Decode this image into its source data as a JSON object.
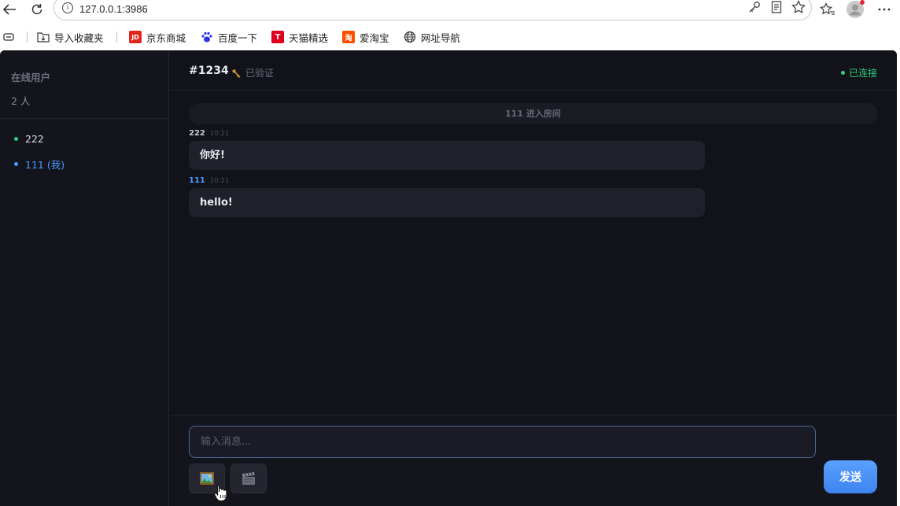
{
  "browser": {
    "url": "127.0.0.1:3986",
    "info_glyph": "i",
    "bookmarks": [
      {
        "label": "导入收藏夹",
        "icon": "folder-import-icon"
      },
      {
        "label": "京东商城",
        "icon": "jd-logo-icon",
        "icon_text": "JD",
        "color": "#e1251b"
      },
      {
        "label": "百度一下",
        "icon": "baidu-paw-icon",
        "color": "#2932e1"
      },
      {
        "label": "天猫精选",
        "icon": "tmall-logo-icon",
        "icon_text": "T",
        "color": "#e0001b"
      },
      {
        "label": "爱淘宝",
        "icon": "taobao-logo-icon",
        "icon_text": "淘",
        "color": "#ff5000"
      },
      {
        "label": "网址导航",
        "icon": "globe-icon"
      }
    ]
  },
  "sidebar": {
    "title": "在线用户",
    "count": "2 人",
    "users": [
      {
        "name": "222",
        "dot_color": "#2fd07a",
        "text_color": "#d9dae2"
      },
      {
        "name": "111 (我)",
        "dot_color": "#4b9cff",
        "text_color": "#4b9cff"
      }
    ]
  },
  "header": {
    "room_id": "#1234",
    "verified_label": "已验证",
    "connection_status": "已连接",
    "status_color": "#2fd07a"
  },
  "messages": {
    "system_notice": "111 进入房间",
    "items": [
      {
        "user": "222",
        "time": "10:21",
        "text": "你好!",
        "user_color": "#c9cad3"
      },
      {
        "user": "111",
        "time": "10:21",
        "text": "hello!",
        "user_color": "#4b9cff"
      }
    ]
  },
  "composer": {
    "placeholder": "输入消息...",
    "image_button": "image-icon",
    "video_button": "clapperboard-icon",
    "send_label": "发送",
    "accent": "#4b93f8"
  }
}
